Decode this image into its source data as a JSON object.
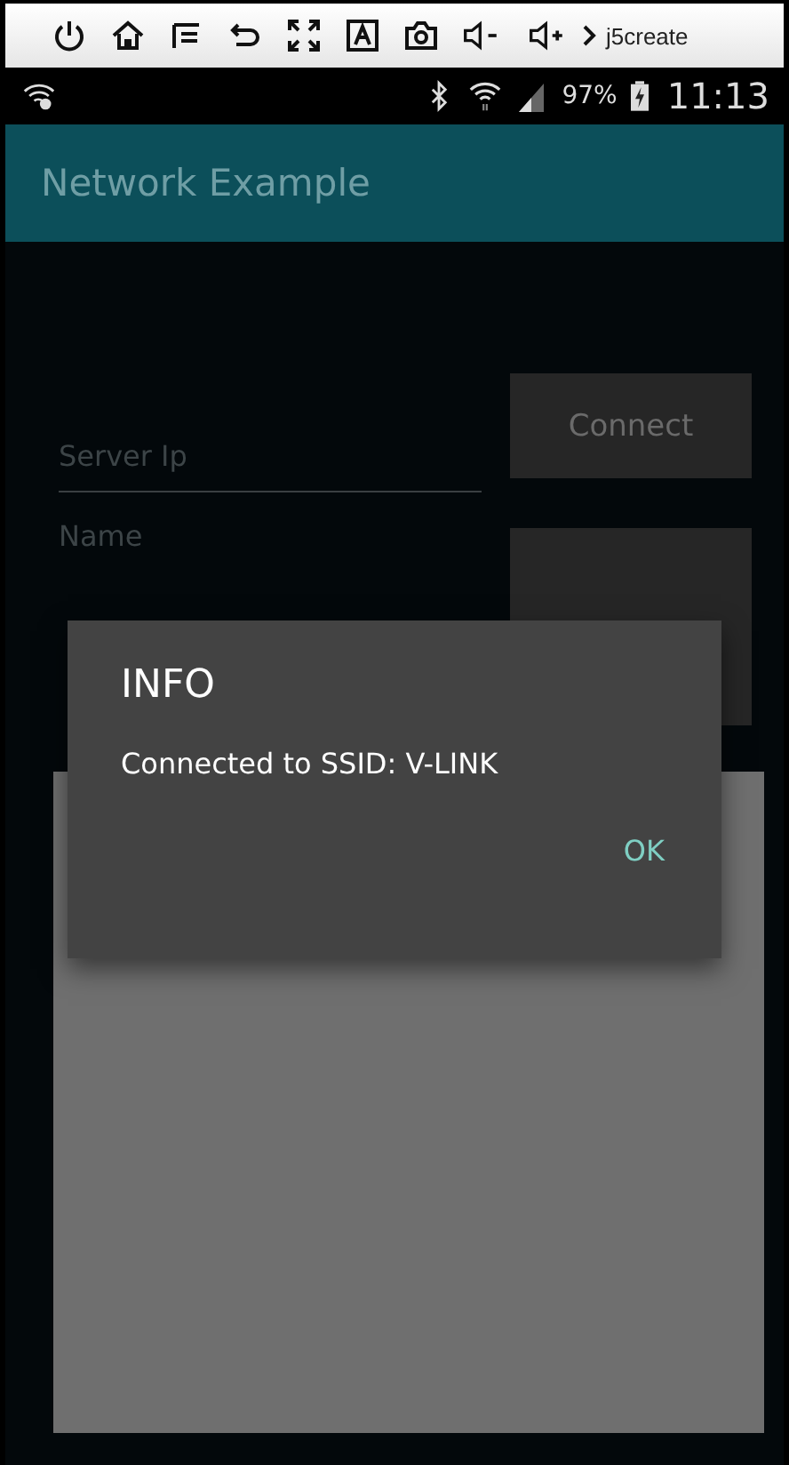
{
  "device_toolbar": {
    "logo": "j5create"
  },
  "status_bar": {
    "battery": "97%",
    "time": "11:13"
  },
  "app_bar": {
    "title": "Network Example"
  },
  "form": {
    "server_field": {
      "placeholder": "Server Ip"
    },
    "connect_button": "Connect",
    "name_field": {
      "placeholder": "Name"
    }
  },
  "dialog": {
    "title": "INFO",
    "message": "Connected to SSID: V-LINK",
    "button": "OK"
  }
}
